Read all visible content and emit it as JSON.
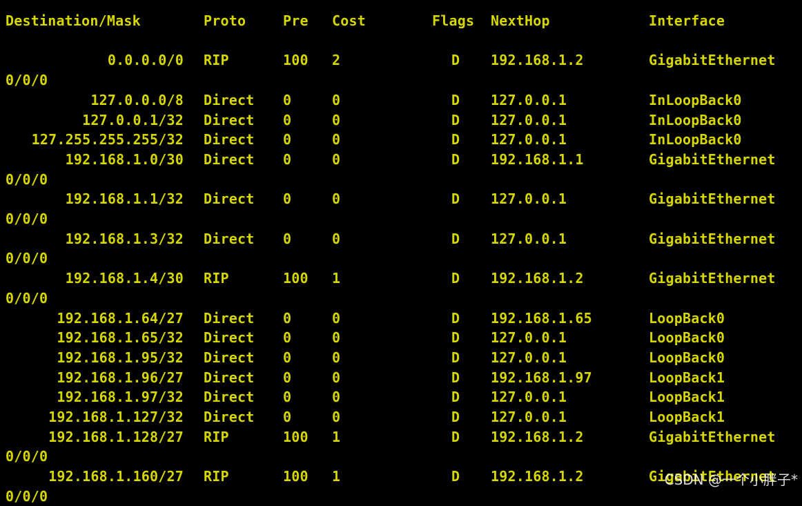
{
  "header": {
    "destination": "Destination/Mask",
    "proto": "Proto",
    "pre": "Pre",
    "cost": "Cost",
    "flags": "Flags",
    "nexthop": "NextHop",
    "interface": "Interface"
  },
  "routes": [
    {
      "dest": "0.0.0.0/0",
      "proto": "RIP",
      "pre": "100",
      "cost": "2",
      "flags": "D",
      "nexthop": "192.168.1.2",
      "iface": "GigabitEthernet",
      "cont": "0/0/0"
    },
    {
      "dest": "127.0.0.0/8",
      "proto": "Direct",
      "pre": "0",
      "cost": "0",
      "flags": "D",
      "nexthop": "127.0.0.1",
      "iface": "InLoopBack0",
      "cont": ""
    },
    {
      "dest": "127.0.0.1/32",
      "proto": "Direct",
      "pre": "0",
      "cost": "0",
      "flags": "D",
      "nexthop": "127.0.0.1",
      "iface": "InLoopBack0",
      "cont": ""
    },
    {
      "dest": "127.255.255.255/32",
      "proto": "Direct",
      "pre": "0",
      "cost": "0",
      "flags": "D",
      "nexthop": "127.0.0.1",
      "iface": "InLoopBack0",
      "cont": ""
    },
    {
      "dest": "192.168.1.0/30",
      "proto": "Direct",
      "pre": "0",
      "cost": "0",
      "flags": "D",
      "nexthop": "192.168.1.1",
      "iface": "GigabitEthernet",
      "cont": "0/0/0"
    },
    {
      "dest": "192.168.1.1/32",
      "proto": "Direct",
      "pre": "0",
      "cost": "0",
      "flags": "D",
      "nexthop": "127.0.0.1",
      "iface": "GigabitEthernet",
      "cont": "0/0/0"
    },
    {
      "dest": "192.168.1.3/32",
      "proto": "Direct",
      "pre": "0",
      "cost": "0",
      "flags": "D",
      "nexthop": "127.0.0.1",
      "iface": "GigabitEthernet",
      "cont": "0/0/0"
    },
    {
      "dest": "192.168.1.4/30",
      "proto": "RIP",
      "pre": "100",
      "cost": "1",
      "flags": "D",
      "nexthop": "192.168.1.2",
      "iface": "GigabitEthernet",
      "cont": "0/0/0"
    },
    {
      "dest": "192.168.1.64/27",
      "proto": "Direct",
      "pre": "0",
      "cost": "0",
      "flags": "D",
      "nexthop": "192.168.1.65",
      "iface": "LoopBack0",
      "cont": ""
    },
    {
      "dest": "192.168.1.65/32",
      "proto": "Direct",
      "pre": "0",
      "cost": "0",
      "flags": "D",
      "nexthop": "127.0.0.1",
      "iface": "LoopBack0",
      "cont": ""
    },
    {
      "dest": "192.168.1.95/32",
      "proto": "Direct",
      "pre": "0",
      "cost": "0",
      "flags": "D",
      "nexthop": "127.0.0.1",
      "iface": "LoopBack0",
      "cont": ""
    },
    {
      "dest": "192.168.1.96/27",
      "proto": "Direct",
      "pre": "0",
      "cost": "0",
      "flags": "D",
      "nexthop": "192.168.1.97",
      "iface": "LoopBack1",
      "cont": ""
    },
    {
      "dest": "192.168.1.97/32",
      "proto": "Direct",
      "pre": "0",
      "cost": "0",
      "flags": "D",
      "nexthop": "127.0.0.1",
      "iface": "LoopBack1",
      "cont": ""
    },
    {
      "dest": "192.168.1.127/32",
      "proto": "Direct",
      "pre": "0",
      "cost": "0",
      "flags": "D",
      "nexthop": "127.0.0.1",
      "iface": "LoopBack1",
      "cont": ""
    },
    {
      "dest": "192.168.1.128/27",
      "proto": "RIP",
      "pre": "100",
      "cost": "1",
      "flags": "D",
      "nexthop": "192.168.1.2",
      "iface": "GigabitEthernet",
      "cont": "0/0/0"
    },
    {
      "dest": "192.168.1.160/27",
      "proto": "RIP",
      "pre": "100",
      "cost": "1",
      "flags": "D",
      "nexthop": "192.168.1.2",
      "iface": "GigabitEthernet",
      "cont": "0/0/0"
    }
  ],
  "watermark": "CSDN @一个小胖子*",
  "colors": {
    "background": "#000000",
    "text": "#d6d600"
  }
}
